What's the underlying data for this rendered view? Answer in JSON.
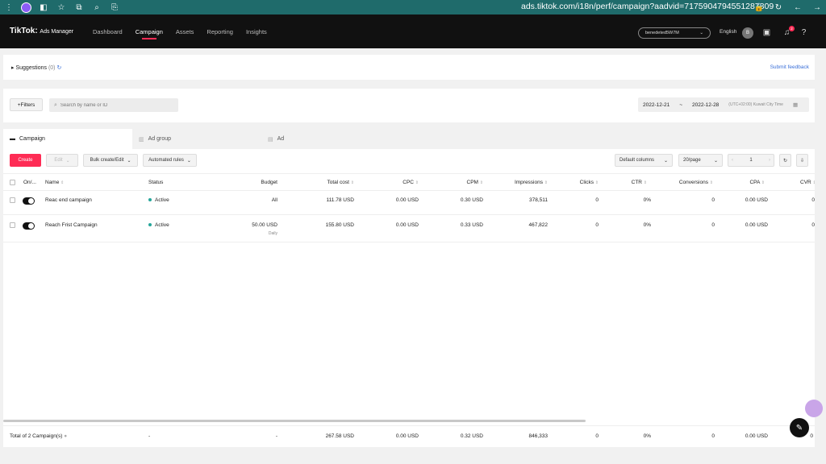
{
  "browser": {
    "url": "ads.tiktok.com/i18n/perf/campaign?aadvid=7175904794551287809"
  },
  "header": {
    "logo": "TikTok",
    "logo_sub": "Ads Manager",
    "nav": [
      "Dashboard",
      "Campaign",
      "Assets",
      "Reporting",
      "Insights"
    ],
    "account": "benedeted5W7M",
    "language": "English",
    "avatar_initial": "B",
    "notifications": "2"
  },
  "suggestions": {
    "label": "Suggestions",
    "count": "(0)",
    "feedback": "Submit feedback"
  },
  "filters": {
    "filters_label": "Filters",
    "search_placeholder": "Search by name or ID",
    "date_start": "2022-12-21",
    "date_sep": "~",
    "date_end": "2022-12-28",
    "timezone": "(UTC+02:00) Kuwait City Time"
  },
  "tabs": [
    "Campaign",
    "Ad group",
    "Ad"
  ],
  "toolbar": {
    "create": "Create",
    "edit": "Edit",
    "bulk": "Bulk create/Edit",
    "rules": "Automated rules",
    "columns": "Default columns",
    "per_page": "20/page",
    "page": "1"
  },
  "table": {
    "headers": [
      "On/...",
      "Name",
      "Status",
      "Budget",
      "Total cost",
      "CPC",
      "CPM",
      "Impressions",
      "Clicks",
      "CTR",
      "Conversions",
      "CPA",
      "CVR"
    ],
    "rows": [
      {
        "name": "Reac end campaign",
        "status": "Active",
        "budget": "All",
        "budget_note": "",
        "total_cost": "111.78 USD",
        "cpc": "0.00 USD",
        "cpm": "0.30 USD",
        "impressions": "378,511",
        "clicks": "0",
        "ctr": "0%",
        "conversions": "0",
        "cpa": "0.00 USD",
        "cvr": "0"
      },
      {
        "name": "Reach Frist Campaign",
        "status": "Active",
        "budget": "50.00 USD",
        "budget_note": "Daily",
        "total_cost": "155.80 USD",
        "cpc": "0.00 USD",
        "cpm": "0.33 USD",
        "impressions": "467,822",
        "clicks": "0",
        "ctr": "0%",
        "conversions": "0",
        "cpa": "0.00 USD",
        "cvr": "0"
      }
    ],
    "totals": {
      "label": "Total of 2 Campaign(s)",
      "status": "-",
      "budget": "-",
      "total_cost": "267.58 USD",
      "cpc": "0.00 USD",
      "cpm": "0.32 USD",
      "impressions": "846,333",
      "clicks": "0",
      "ctr": "0%",
      "conversions": "0",
      "cpa": "0.00 USD",
      "cvr": "0"
    }
  },
  "colors": {
    "accent": "#fe2c55",
    "status_active": "#26a69a",
    "browser_bar": "#1f6b6b"
  }
}
